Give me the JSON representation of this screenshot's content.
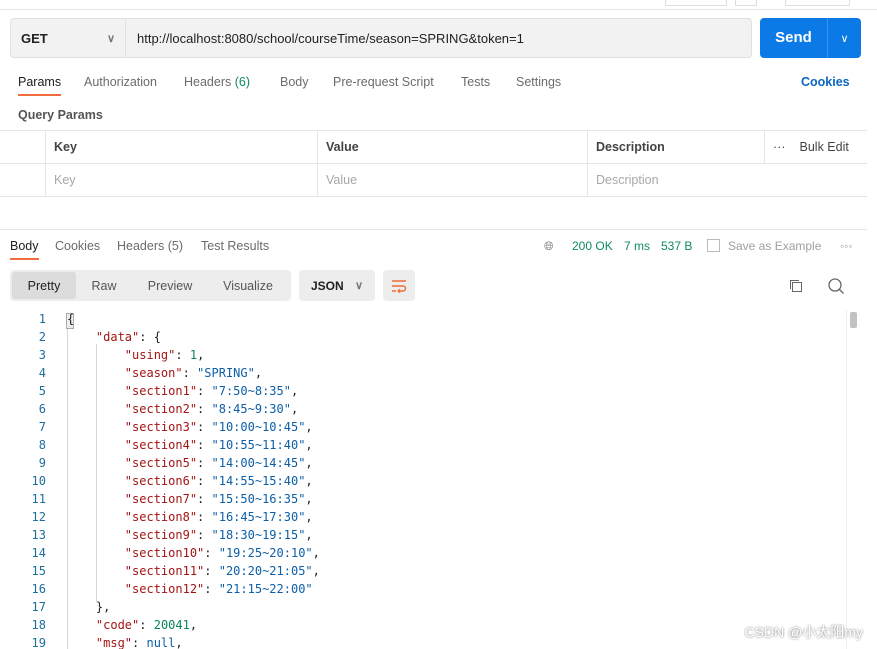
{
  "request": {
    "method": "GET",
    "url": "http://localhost:8080/school/courseTime/season=SPRING&token=1",
    "send_label": "Send"
  },
  "req_tabs": [
    {
      "label": "Params"
    },
    {
      "label": "Authorization"
    },
    {
      "label": "Headers",
      "count": "(6)"
    },
    {
      "label": "Body"
    },
    {
      "label": "Pre-request Script"
    },
    {
      "label": "Tests"
    },
    {
      "label": "Settings"
    }
  ],
  "cookies_label": "Cookies",
  "query_params": {
    "title": "Query Params",
    "headers": [
      "Key",
      "Value",
      "Description"
    ],
    "bulk_edit": "Bulk Edit",
    "placeholders": [
      "Key",
      "Value",
      "Description"
    ]
  },
  "resp_tabs": [
    {
      "label": "Body"
    },
    {
      "label": "Cookies"
    },
    {
      "label": "Headers (5)"
    },
    {
      "label": "Test Results"
    }
  ],
  "status": {
    "code": "200 OK",
    "time": "7 ms",
    "size": "537 B",
    "save": "Save as Example"
  },
  "view_modes": [
    "Pretty",
    "Raw",
    "Preview",
    "Visualize"
  ],
  "format": "JSON",
  "code_lines": [
    [
      [
        "p",
        "{"
      ]
    ],
    [
      [
        "p",
        "    "
      ],
      [
        "k",
        "\"data\""
      ],
      [
        "p",
        ": {"
      ]
    ],
    [
      [
        "p",
        "        "
      ],
      [
        "k",
        "\"using\""
      ],
      [
        "p",
        ": "
      ],
      [
        "n",
        "1"
      ],
      [
        "p",
        ","
      ]
    ],
    [
      [
        "p",
        "        "
      ],
      [
        "k",
        "\"season\""
      ],
      [
        "p",
        ": "
      ],
      [
        "s",
        "\"SPRING\""
      ],
      [
        "p",
        ","
      ]
    ],
    [
      [
        "p",
        "        "
      ],
      [
        "k",
        "\"section1\""
      ],
      [
        "p",
        ": "
      ],
      [
        "s",
        "\"7:50~8:35\""
      ],
      [
        "p",
        ","
      ]
    ],
    [
      [
        "p",
        "        "
      ],
      [
        "k",
        "\"section2\""
      ],
      [
        "p",
        ": "
      ],
      [
        "s",
        "\"8:45~9:30\""
      ],
      [
        "p",
        ","
      ]
    ],
    [
      [
        "p",
        "        "
      ],
      [
        "k",
        "\"section3\""
      ],
      [
        "p",
        ": "
      ],
      [
        "s",
        "\"10:00~10:45\""
      ],
      [
        "p",
        ","
      ]
    ],
    [
      [
        "p",
        "        "
      ],
      [
        "k",
        "\"section4\""
      ],
      [
        "p",
        ": "
      ],
      [
        "s",
        "\"10:55~11:40\""
      ],
      [
        "p",
        ","
      ]
    ],
    [
      [
        "p",
        "        "
      ],
      [
        "k",
        "\"section5\""
      ],
      [
        "p",
        ": "
      ],
      [
        "s",
        "\"14:00~14:45\""
      ],
      [
        "p",
        ","
      ]
    ],
    [
      [
        "p",
        "        "
      ],
      [
        "k",
        "\"section6\""
      ],
      [
        "p",
        ": "
      ],
      [
        "s",
        "\"14:55~15:40\""
      ],
      [
        "p",
        ","
      ]
    ],
    [
      [
        "p",
        "        "
      ],
      [
        "k",
        "\"section7\""
      ],
      [
        "p",
        ": "
      ],
      [
        "s",
        "\"15:50~16:35\""
      ],
      [
        "p",
        ","
      ]
    ],
    [
      [
        "p",
        "        "
      ],
      [
        "k",
        "\"section8\""
      ],
      [
        "p",
        ": "
      ],
      [
        "s",
        "\"16:45~17:30\""
      ],
      [
        "p",
        ","
      ]
    ],
    [
      [
        "p",
        "        "
      ],
      [
        "k",
        "\"section9\""
      ],
      [
        "p",
        ": "
      ],
      [
        "s",
        "\"18:30~19:15\""
      ],
      [
        "p",
        ","
      ]
    ],
    [
      [
        "p",
        "        "
      ],
      [
        "k",
        "\"section10\""
      ],
      [
        "p",
        ": "
      ],
      [
        "s",
        "\"19:25~20:10\""
      ],
      [
        "p",
        ","
      ]
    ],
    [
      [
        "p",
        "        "
      ],
      [
        "k",
        "\"section11\""
      ],
      [
        "p",
        ": "
      ],
      [
        "s",
        "\"20:20~21:05\""
      ],
      [
        "p",
        ","
      ]
    ],
    [
      [
        "p",
        "        "
      ],
      [
        "k",
        "\"section12\""
      ],
      [
        "p",
        ": "
      ],
      [
        "s",
        "\"21:15~22:00\""
      ]
    ],
    [
      [
        "p",
        "    },"
      ]
    ],
    [
      [
        "p",
        "    "
      ],
      [
        "k",
        "\"code\""
      ],
      [
        "p",
        ": "
      ],
      [
        "n",
        "20041"
      ],
      [
        "p",
        ","
      ]
    ],
    [
      [
        "p",
        "    "
      ],
      [
        "k",
        "\"msg\""
      ],
      [
        "p",
        ": "
      ],
      [
        "s",
        "null"
      ],
      [
        "p",
        ","
      ]
    ]
  ],
  "watermark": "CSDN @小太阳my",
  "colors": {
    "accent": "#0c7ae6",
    "tab_indicator": "#f26b3a",
    "status": "#0f8a5f"
  }
}
